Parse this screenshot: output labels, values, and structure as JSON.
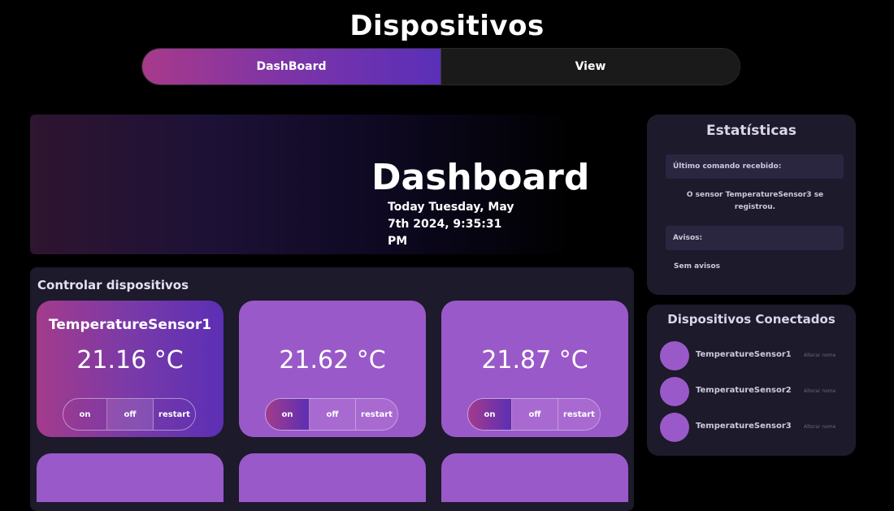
{
  "page": {
    "title": "Dispositivos"
  },
  "tabs": [
    {
      "label": "DashBoard",
      "active": true
    },
    {
      "label": "View",
      "active": false
    }
  ],
  "hero": {
    "title": "Dashboard",
    "date_line1": "Today Tuesday, May",
    "date_line2": "7th 2024, 9:35:31 PM"
  },
  "control": {
    "heading": "Controlar dispositivos",
    "devices": [
      {
        "name": "TemperatureSensor1",
        "temperature": "21.16 °C"
      },
      {
        "name": "",
        "temperature": "21.62 °C"
      },
      {
        "name": "",
        "temperature": "21.87 °C"
      }
    ],
    "buttons": {
      "on": "on",
      "off": "off",
      "restart": "restart"
    }
  },
  "stats": {
    "title": "Estatísticas",
    "last_command_label": "Último comando recebido:",
    "last_command_value": "O sensor TemperatureSensor3 se registrou.",
    "warnings_label": "Avisos:",
    "warnings_value": "Sem avisos"
  },
  "connected": {
    "title": "Dispositivos Conectados",
    "rename_label": "Alterar nome",
    "devices": [
      "TemperatureSensor1",
      "TemperatureSensor2",
      "TemperatureSensor3"
    ]
  },
  "colors": {
    "background": "#000000",
    "panel": "#1c1a2b",
    "card": "#9a59c8",
    "gradient_start": "#a33b8b",
    "gradient_end": "#5c2fb5"
  }
}
